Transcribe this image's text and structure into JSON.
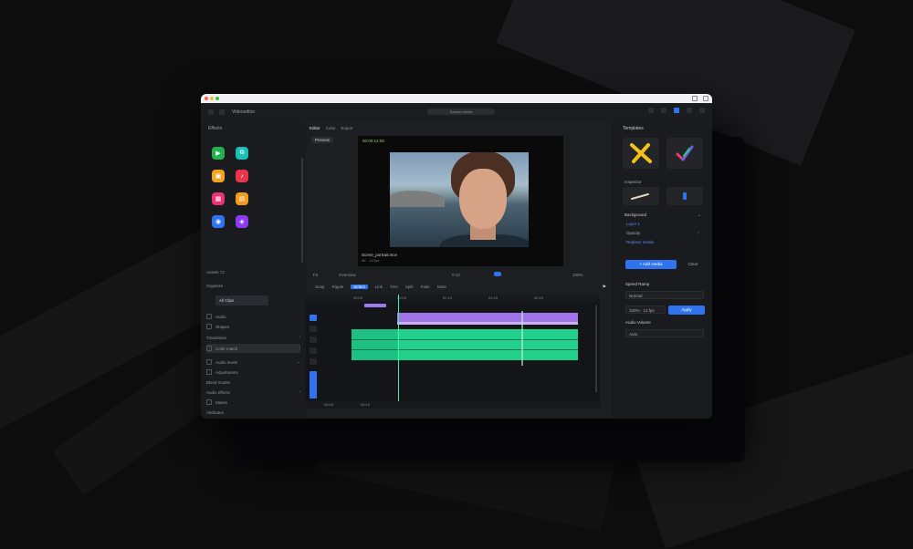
{
  "window": {
    "title": "Videoeditor"
  },
  "header": {
    "search": "Search media"
  },
  "left": {
    "heading": "Effects",
    "apps": [
      {
        "glyph": "▶",
        "color": "#22b24c"
      },
      {
        "glyph": "⧉",
        "color": "#19c0b5"
      },
      {
        "glyph": "▣",
        "color": "#f2a41f"
      },
      {
        "glyph": "♪",
        "color": "#e9354a"
      },
      {
        "glyph": "▦",
        "color": "#ea2f77"
      },
      {
        "glyph": "▤",
        "color": "#f59b1a"
      },
      {
        "glyph": "◉",
        "color": "#2f74ee"
      },
      {
        "glyph": "◈",
        "color": "#8b3cf0"
      }
    ],
    "section1": "Assets 72",
    "section2": "Organize",
    "pill": "All Clips",
    "rows": [
      "Audio",
      "Shapes",
      "Transitions",
      "Color match",
      "Audio levels",
      "Adjustments",
      "Blend modes",
      "Audio effects",
      "Masks",
      "Attributes"
    ]
  },
  "center": {
    "tabs": [
      "Editor",
      "Color",
      "Export"
    ],
    "preview_label": "Preview",
    "timecode": "00:00:12:08",
    "caption": "Scene_portrait.mov",
    "caption2": "4K · 24 fps",
    "transport": [
      "Fit",
      "Overview",
      "0:12",
      "100%"
    ],
    "toolbar": [
      "Snap",
      "Ripple",
      "Link",
      "Trim",
      "Split",
      "Fade",
      "Mute"
    ],
    "toolbar_active": "Select",
    "ruler": [
      "00:00",
      "00:05",
      "00:10",
      "00:15",
      "00:20"
    ],
    "bottom": [
      "00:00",
      "00:15"
    ]
  },
  "right": {
    "heading": "Templates",
    "label1": "Inspector",
    "subheading": "Background",
    "link1": "Layer 1",
    "link2": "Opacity",
    "link3": "Replace media",
    "primary": "+ Add media",
    "ghost": "Clear",
    "speed_heading": "Speed Ramp",
    "field1": "Normal",
    "field2": "100% · 12 fps",
    "button": "Apply",
    "audio_heading": "Audio Volume",
    "field3": "Auto"
  }
}
